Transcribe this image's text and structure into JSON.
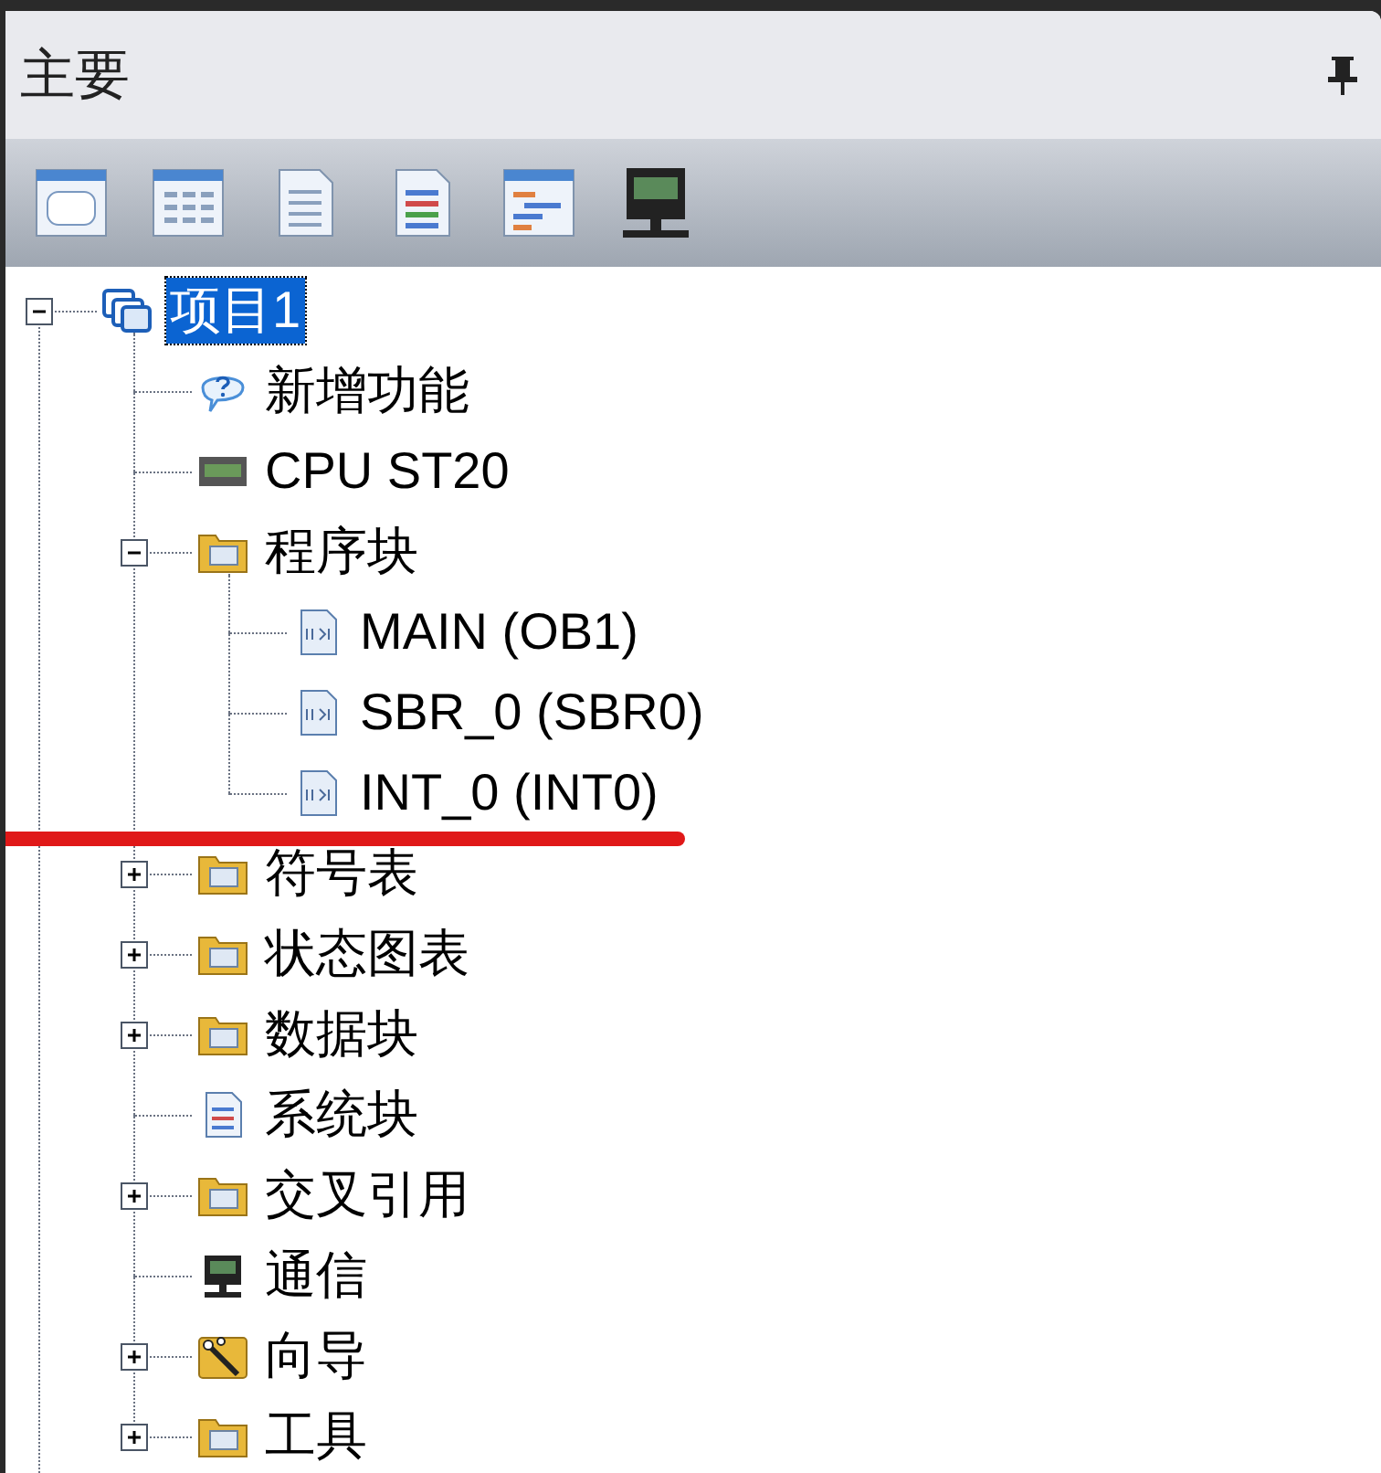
{
  "panel": {
    "title": "主要"
  },
  "toolbar": [
    {
      "kind": "tag"
    },
    {
      "kind": "table"
    },
    {
      "kind": "doc"
    },
    {
      "kind": "list"
    },
    {
      "kind": "chart"
    },
    {
      "kind": "monitor"
    }
  ],
  "tree": [
    {
      "label": "项目1",
      "kind": "project",
      "selected": true,
      "expanded": true,
      "children": [
        {
          "label": "新增功能",
          "kind": "help",
          "selected": false
        },
        {
          "label": "CPU ST20",
          "kind": "cpu",
          "selected": false
        },
        {
          "label": "程序块",
          "kind": "folder",
          "selected": false,
          "expanded": true,
          "children": [
            {
              "label": "MAIN (OB1)",
              "kind": "ladder",
              "selected": false
            },
            {
              "label": "SBR_0 (SBR0)",
              "kind": "ladder",
              "selected": false
            },
            {
              "label": "INT_0 (INT0)",
              "kind": "ladder",
              "selected": false,
              "underlined": true
            }
          ]
        },
        {
          "label": "符号表",
          "kind": "folder",
          "selected": false,
          "expanded": false
        },
        {
          "label": "状态图表",
          "kind": "folder",
          "selected": false,
          "expanded": false
        },
        {
          "label": "数据块",
          "kind": "folder",
          "selected": false,
          "expanded": false
        },
        {
          "label": "系统块",
          "kind": "system",
          "selected": false
        },
        {
          "label": "交叉引用",
          "kind": "folder",
          "selected": false,
          "expanded": false
        },
        {
          "label": "通信",
          "kind": "monitor",
          "selected": false
        },
        {
          "label": "向导",
          "kind": "wizard",
          "selected": false,
          "expanded": false
        },
        {
          "label": "工具",
          "kind": "folder",
          "selected": false,
          "expanded": false
        }
      ]
    }
  ]
}
